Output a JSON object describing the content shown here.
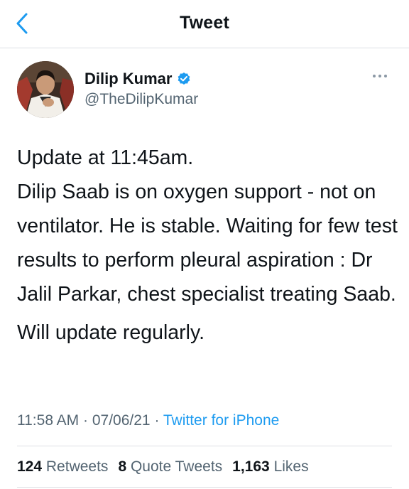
{
  "header": {
    "title": "Tweet"
  },
  "colors": {
    "accent": "#1d9bf0",
    "text": "#0f1419",
    "muted": "#536471"
  },
  "author": {
    "display_name": "Dilip Kumar",
    "handle": "@TheDilipKumar",
    "verified_icon": "verified-badge-icon"
  },
  "tweet": {
    "paragraph_1": "Update at 11:45am.\nDilip Saab is on oxygen support - not on ventilator.  He is stable. Waiting for few test results to perform pleural aspiration : Dr Jalil Parkar, chest specialist treating Saab.",
    "paragraph_2": "Will update regularly."
  },
  "meta": {
    "time": "11:58 AM",
    "date": "07/06/21",
    "source": "Twitter for iPhone"
  },
  "stats": {
    "retweets_count": "124",
    "retweets_label": "Retweets",
    "quotes_count": "8",
    "quotes_label": "Quote Tweets",
    "likes_count": "1,163",
    "likes_label": "Likes"
  }
}
